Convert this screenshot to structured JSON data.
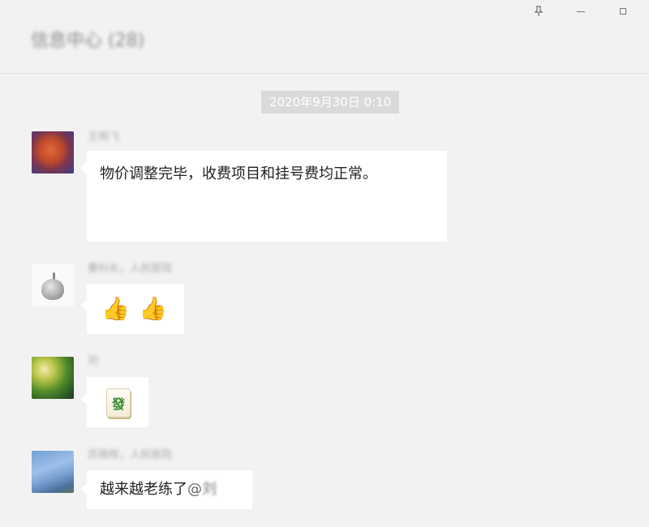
{
  "header": {
    "title": "信息中心 (28)",
    "controls": {
      "pin_icon": "pin-icon",
      "minimize_icon": "minimize-icon",
      "maximize_icon": "maximize-icon"
    }
  },
  "timestamp": "2020年9月30日 0:10",
  "messages": [
    {
      "sender": "王明飞",
      "text": "物价调整完毕，收费项目和挂号费均正常。"
    },
    {
      "sender": "曹科长，人民医院",
      "emoji": [
        "👍",
        "👍"
      ]
    },
    {
      "sender": "刘",
      "emoji_tile": "發"
    },
    {
      "sender": "苏晓晖，人民医院",
      "text": "越来越老练了",
      "mention_at": "@",
      "mention_name": "刘"
    }
  ],
  "colors": {
    "background": "#f2f2f2",
    "bubble": "#ffffff",
    "timestamp_bg": "#dadada"
  }
}
